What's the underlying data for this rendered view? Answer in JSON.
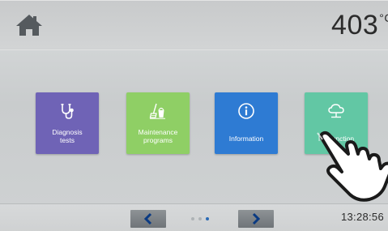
{
  "header": {
    "home_icon": "home-icon",
    "temperature": "403",
    "temperature_unit": "°C"
  },
  "tiles": [
    {
      "label": "Diagnosis tests",
      "icon": "stethoscope-icon",
      "color": "#6f63b6"
    },
    {
      "label": "Maintenance programs",
      "icon": "broom-bucket-icon",
      "color": "#8fcf65"
    },
    {
      "label": "Information",
      "icon": "info-icon",
      "color": "#2e7bd3"
    },
    {
      "label": "IoT function",
      "icon": "cloud-icon",
      "color": "#62c7a4"
    }
  ],
  "footer": {
    "prev_icon": "chevron-left-icon",
    "next_icon": "chevron-right-icon",
    "page_count": 3,
    "active_page": 3,
    "time": "13:28:56"
  }
}
